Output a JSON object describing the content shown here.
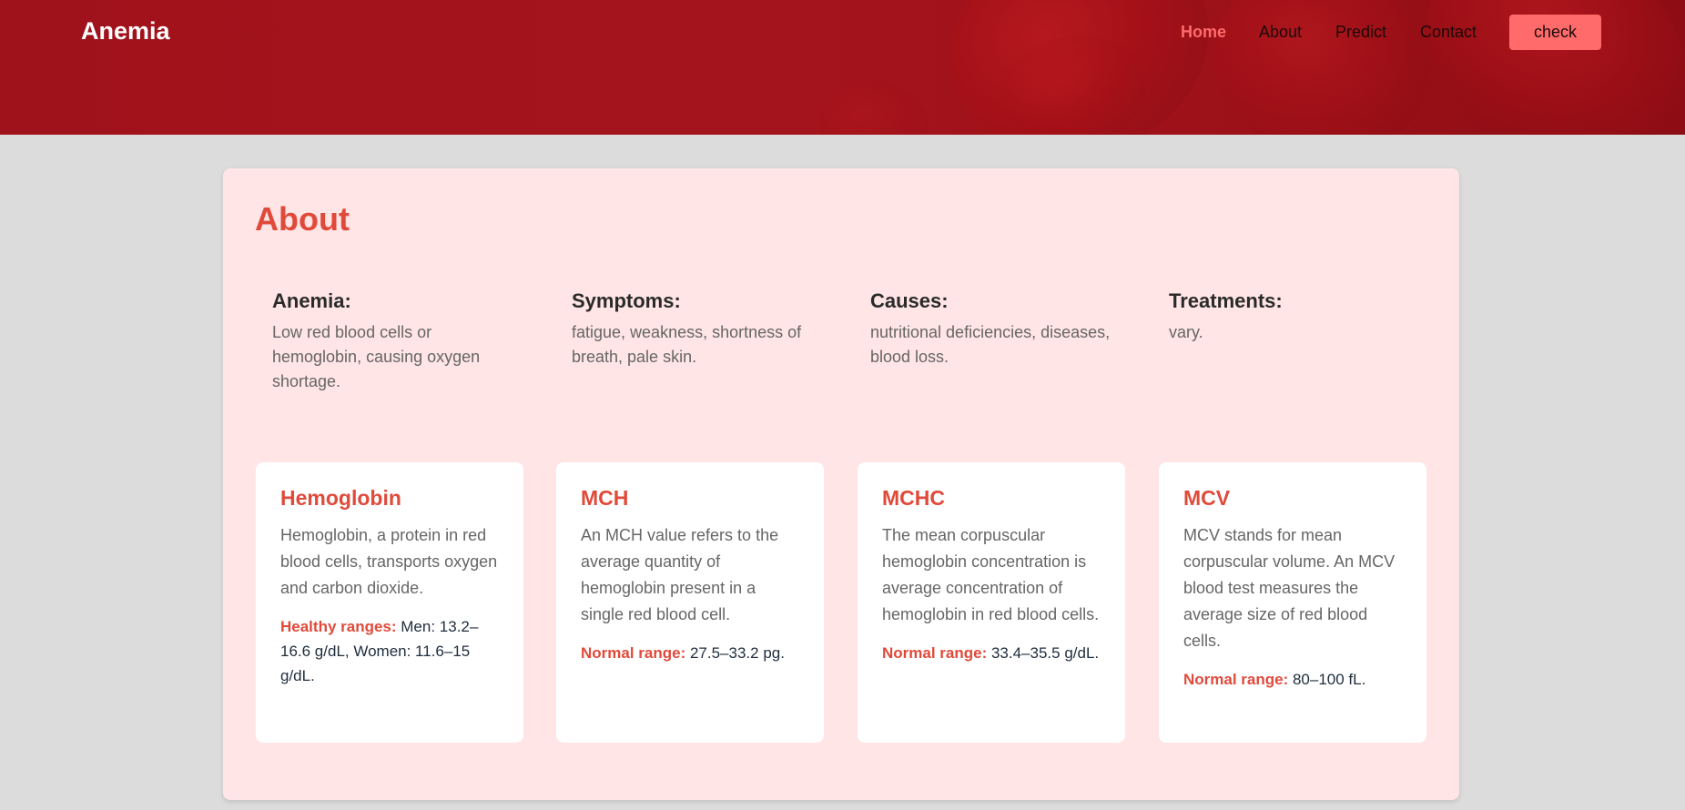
{
  "header": {
    "logo": "Anemia",
    "nav": [
      {
        "label": "Home",
        "active": true
      },
      {
        "label": "About",
        "active": false
      },
      {
        "label": "Predict",
        "active": false
      },
      {
        "label": "Contact",
        "active": false
      }
    ],
    "check_button": "check"
  },
  "about": {
    "title": "About",
    "info": [
      {
        "heading": "Anemia:",
        "text": "Low red blood cells or hemoglobin, causing oxygen shortage."
      },
      {
        "heading": "Symptoms:",
        "text": "fatigue, weakness, shortness of breath, pale skin."
      },
      {
        "heading": "Causes:",
        "text": "nutritional deficiencies, diseases, blood loss."
      },
      {
        "heading": "Treatments:",
        "text": "vary."
      }
    ],
    "cards": [
      {
        "title": "Hemoglobin",
        "description": "Hemoglobin, a protein in red blood cells, transports oxygen and carbon dioxide.",
        "range_label": "Healthy ranges:",
        "range_value": " Men: 13.2–16.6 g/dL, Women: 11.6–15 g/dL."
      },
      {
        "title": "MCH",
        "description": "An MCH value refers to the average quantity of hemoglobin present in a single red blood cell.",
        "range_label": "Normal range:",
        "range_value": " 27.5–33.2 pg."
      },
      {
        "title": "MCHC",
        "description": "The mean corpuscular hemoglobin concentration is average concentration of hemoglobin in red blood cells.",
        "range_label": "Normal range:",
        "range_value": " 33.4–35.5 g/dL."
      },
      {
        "title": "MCV",
        "description": "MCV stands for mean corpuscular volume. An MCV blood test measures the average size of red blood cells.",
        "range_label": "Normal range:",
        "range_value": " 80–100 fL."
      }
    ]
  },
  "colors": {
    "header_bg": "#a0121b",
    "accent": "#e04a3a",
    "nav_active": "#ff6b6b",
    "button_bg": "#ff6b6b",
    "panel_bg": "#ffe5e5",
    "page_bg": "#dcdcdc"
  }
}
